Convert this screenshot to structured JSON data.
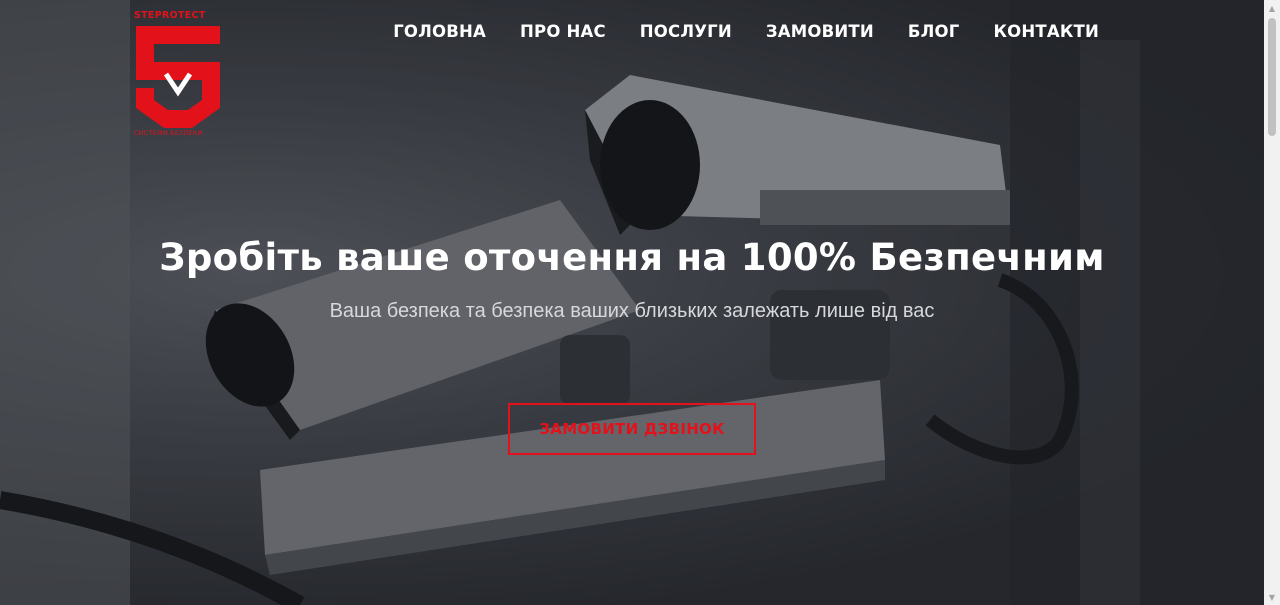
{
  "logo": {
    "top_text": "STEPROTECT",
    "bottom_text": "СИСТЕМИ БЕЗПЕКИ",
    "color": "#e3121a",
    "icon": "shield-s-logo-icon"
  },
  "nav": {
    "items": [
      {
        "label": "ГОЛОВНА"
      },
      {
        "label": "ПРО НАС"
      },
      {
        "label": "ПОСЛУГИ"
      },
      {
        "label": "ЗАМОВИТИ"
      },
      {
        "label": "БЛОГ"
      },
      {
        "label": "КОНТАКТИ"
      }
    ]
  },
  "hero": {
    "title": "Зробіть ваше оточення на 100% Безпечним",
    "subtitle": "Ваша безпека та безпека ваших близьких залежать лише від вас",
    "cta_label": "ЗАМОВИТИ ДЗВІНОК",
    "background_image": "cctv-cameras-photo"
  },
  "colors": {
    "accent": "#e3121a",
    "text": "#ffffff"
  }
}
